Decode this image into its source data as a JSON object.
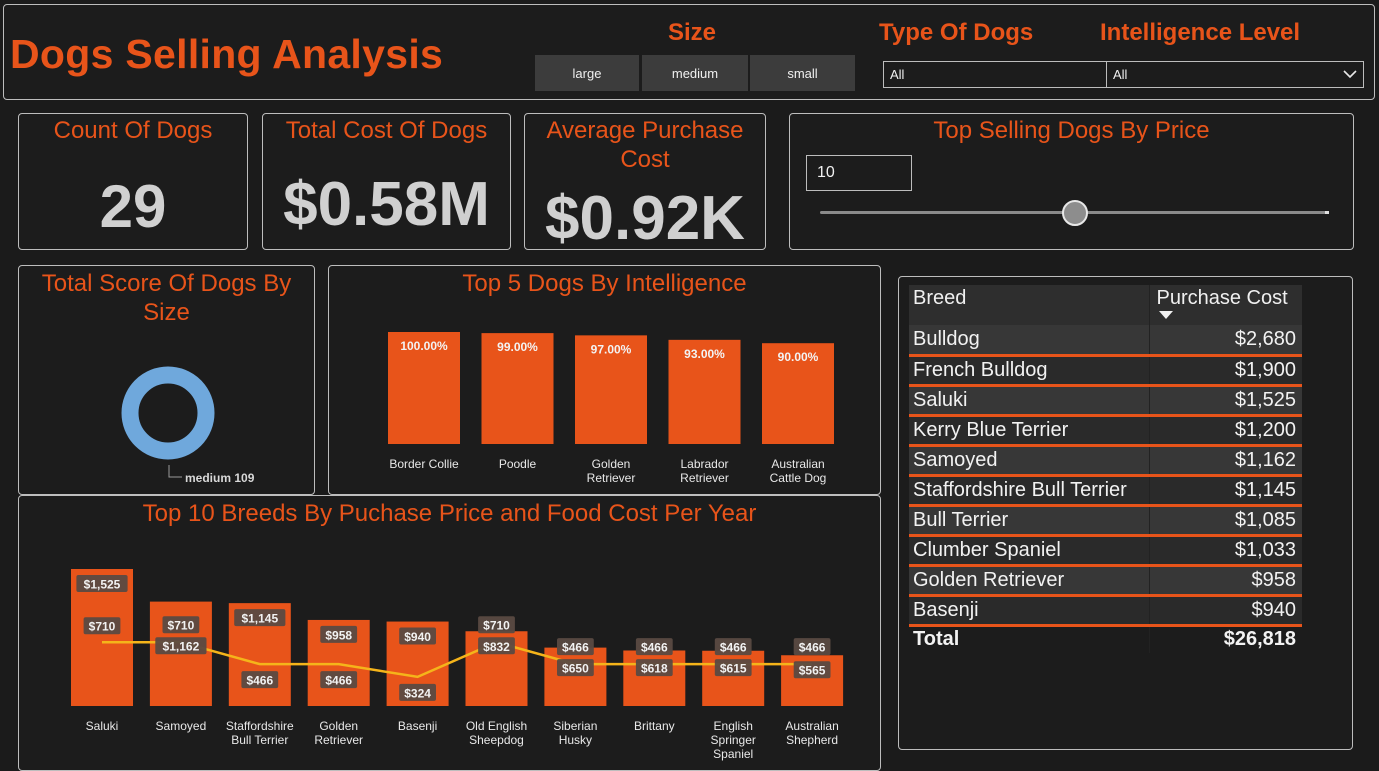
{
  "header": {
    "title": "Dogs Selling Analysis",
    "size_label": "Size",
    "size_options": [
      "large",
      "medium",
      "small"
    ],
    "type_label": "Type Of Dogs",
    "type_value": "All",
    "intel_label": "Intelligence Level",
    "intel_value": "All"
  },
  "kpis": {
    "count_label": "Count Of Dogs",
    "count_value": "29",
    "total_label": "Total Cost Of Dogs",
    "total_value": "$0.58M",
    "avg_label": "Average Purchase Cost",
    "avg_value": "$0.92K"
  },
  "slider": {
    "label": "Top Selling Dogs By Price",
    "value": "10",
    "level": 0.5
  },
  "donut": {
    "title": "Total Score Of Dogs By Size",
    "label": "medium 109",
    "color": "#6fa8dc"
  },
  "table": {
    "headers": [
      "Breed",
      "Purchase Cost"
    ],
    "rows": [
      {
        "breed": "Bulldog",
        "cost": "$2,680"
      },
      {
        "breed": "French Bulldog",
        "cost": "$1,900"
      },
      {
        "breed": "Saluki",
        "cost": "$1,525"
      },
      {
        "breed": "Kerry Blue Terrier",
        "cost": "$1,200"
      },
      {
        "breed": "Samoyed",
        "cost": "$1,162"
      },
      {
        "breed": "Staffordshire Bull Terrier",
        "cost": "$1,145"
      },
      {
        "breed": "Bull Terrier",
        "cost": "$1,085"
      },
      {
        "breed": "Clumber Spaniel",
        "cost": "$1,033"
      },
      {
        "breed": "Golden Retriever",
        "cost": "$958"
      },
      {
        "breed": "Basenji",
        "cost": "$940"
      }
    ],
    "total_label": "Total",
    "total_value": "$26,818"
  },
  "colors": {
    "accent": "#e8541a",
    "line": "#f5b41a",
    "donut": "#6fa8dc"
  },
  "chart_data": [
    {
      "type": "bar",
      "title": "Top 5 Dogs By Intelligence",
      "categories": [
        [
          "Border Collie"
        ],
        [
          "Poodle"
        ],
        [
          "Golden",
          "Retriever"
        ],
        [
          "Labrador",
          "Retriever"
        ],
        [
          "Australian",
          "Cattle Dog"
        ]
      ],
      "values": [
        100,
        99,
        97,
        93,
        90
      ],
      "labels": [
        "100.00%",
        "99.00%",
        "97.00%",
        "93.00%",
        "90.00%"
      ],
      "ylim": [
        0,
        100
      ]
    },
    {
      "type": "bar",
      "title": "Top 10 Breeds By Puchase Price and Food Cost Per Year",
      "categories": [
        [
          "Saluki"
        ],
        [
          "Samoyed"
        ],
        [
          "Staffordshire",
          "Bull Terrier"
        ],
        [
          "Golden",
          "Retriever"
        ],
        [
          "Basenji"
        ],
        [
          "Old English",
          "Sheepdog"
        ],
        [
          "Siberian",
          "Husky"
        ],
        [
          "Brittany"
        ],
        [
          "English",
          "Springer",
          "Spaniel"
        ],
        [
          "Australian",
          "Shepherd"
        ]
      ],
      "series": [
        {
          "type": "bar",
          "values": [
            1525,
            1162,
            1145,
            958,
            940,
            832,
            650,
            618,
            615,
            565
          ],
          "labels": [
            "$1,525",
            "$1,162",
            "$1,145",
            "$958",
            "$940",
            "$832",
            "$650",
            "$618",
            "$615",
            "$565"
          ]
        },
        {
          "type": "line",
          "values": [
            710,
            710,
            466,
            466,
            324,
            710,
            466,
            466,
            466,
            466
          ],
          "labels": [
            "$710",
            "$710",
            "$466",
            "$466",
            "$324",
            "$710",
            "$466",
            "$466",
            "$466",
            "$466"
          ]
        }
      ],
      "ylim": [
        0,
        1525
      ]
    }
  ]
}
